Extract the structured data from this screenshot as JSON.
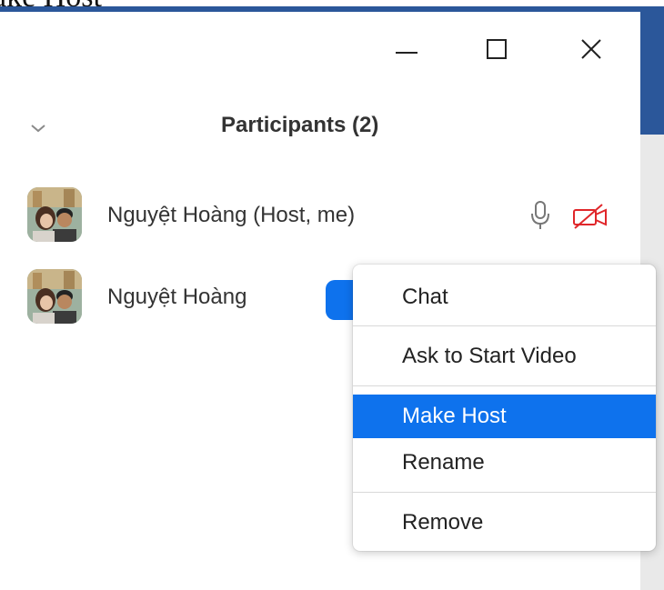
{
  "doc_text": "ake Host",
  "window": {
    "title": "Participants (2)",
    "controls": {
      "minimize_icon": "minimize-icon",
      "maximize_icon": "maximize-icon",
      "close_icon": "close-icon"
    }
  },
  "participants": [
    {
      "name": "Nguyệt Hoàng (Host, me)",
      "mic": "mic-icon",
      "video": "video-off-icon"
    },
    {
      "name": "Nguyệt Hoàng"
    }
  ],
  "context_menu": {
    "items": [
      {
        "label": "Chat"
      },
      {
        "label": "Ask to Start Video"
      },
      {
        "label": "Make Host",
        "selected": true
      },
      {
        "label": "Rename"
      },
      {
        "label": "Remove"
      }
    ]
  },
  "colors": {
    "accent": "#0e72ed",
    "app_bar": "#2b579a",
    "video_off": "#e0262a",
    "text": "#333333"
  }
}
